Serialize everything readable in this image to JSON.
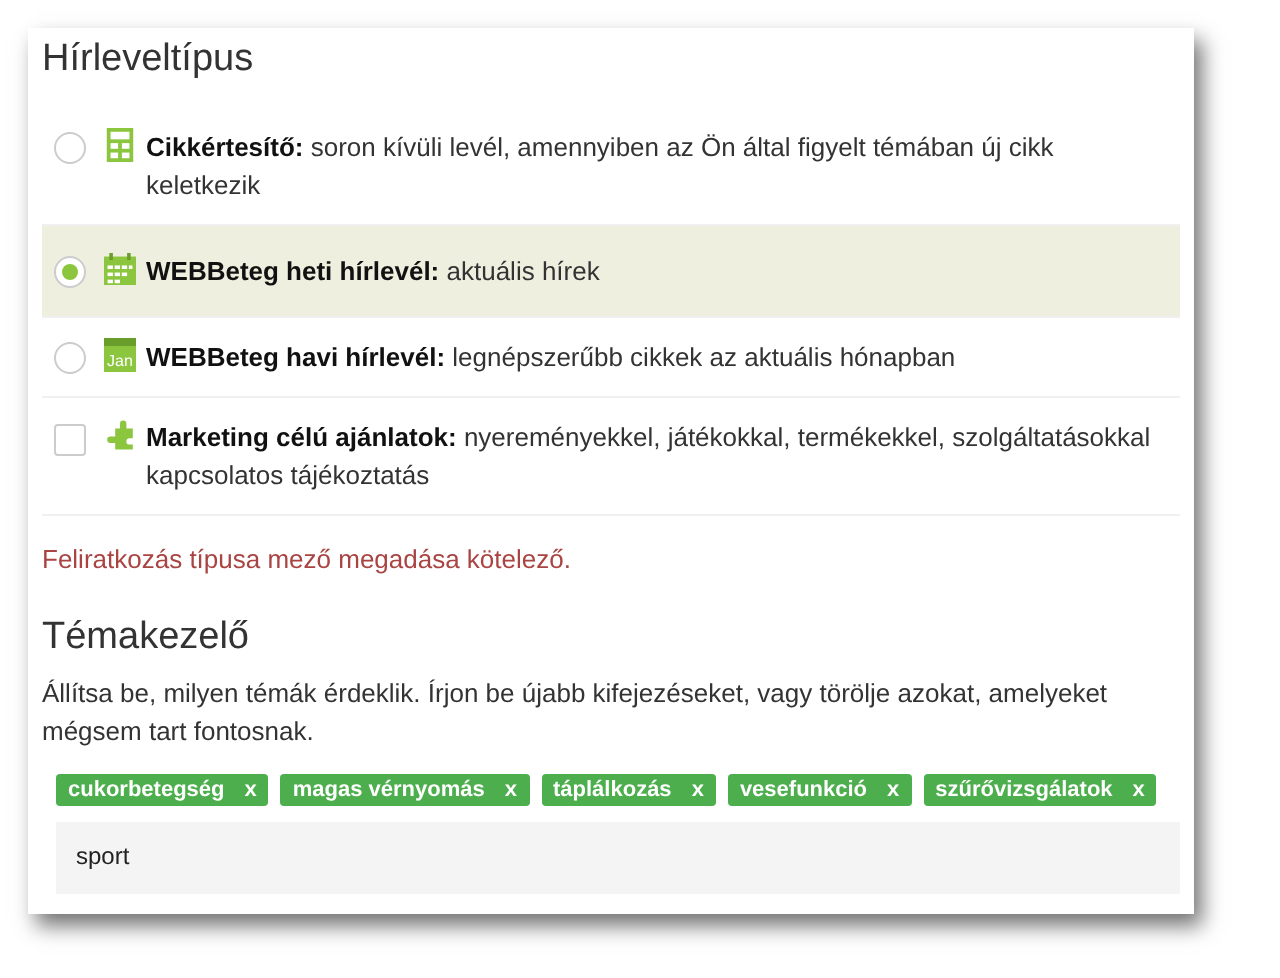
{
  "newsletter_type": {
    "title": "Hírleveltípus",
    "options": [
      {
        "kind": "radio",
        "selected": false,
        "label": "Cikkértesítő:",
        "description": "soron kívüli levél, amennyiben az Ön által figyelt témában új cikk keletkezik"
      },
      {
        "kind": "radio",
        "selected": true,
        "label": "WEBBeteg heti hírlevél:",
        "description": "aktuális hírek"
      },
      {
        "kind": "radio",
        "icon_text": "Jan",
        "selected": false,
        "label": "WEBBeteg havi hírlevél:",
        "description": "legnépszerűbb cikkek az aktuális hónapban"
      },
      {
        "kind": "checkbox",
        "checked": false,
        "label": "Marketing célú ajánlatok:",
        "description": "nyereményekkel, játékokkal, termékekkel, szolgáltatásokkal kapcsolatos tájékoztatás"
      }
    ],
    "error": "Feliratkozás típusa mező megadása kötelező."
  },
  "topic_manager": {
    "title": "Témakezelő",
    "description": "Állítsa be, milyen témák érdeklik. Írjon be újabb kifejezéseket, vagy törölje azokat, amelyeket mégsem tart fontosnak.",
    "tags": [
      {
        "label": "cukorbetegség",
        "remove": "x"
      },
      {
        "label": "magas vérnyomás",
        "remove": "x"
      },
      {
        "label": "táplálkozás",
        "remove": "x"
      },
      {
        "label": "vesefunkció",
        "remove": "x"
      },
      {
        "label": "szűrővizsgálatok",
        "remove": "x"
      }
    ],
    "input": {
      "value": "sport"
    }
  }
}
